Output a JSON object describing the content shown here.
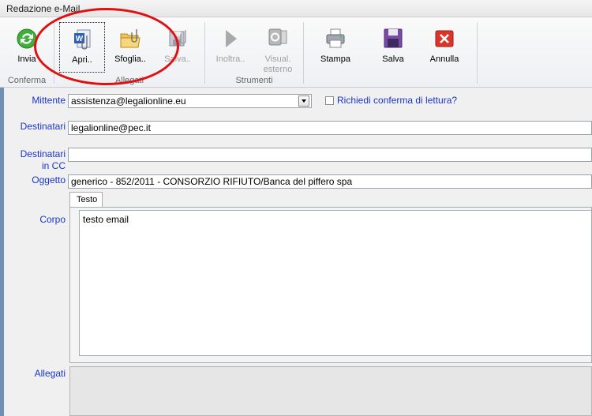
{
  "window": {
    "title": "Redazione e-Mail"
  },
  "ribbon": {
    "groups": [
      {
        "label": "Conferma"
      },
      {
        "label": "Allegati"
      },
      {
        "label": "Strumenti"
      }
    ],
    "buttons": {
      "invia": "Invia",
      "apri": "Apri..",
      "sfoglia": "Sfoglia..",
      "salva_allegato": "Salva..",
      "inoltra": "Inoltra..",
      "visual_esterno_1": "Visual.",
      "visual_esterno_2": "esterno",
      "stampa": "Stampa",
      "salva": "Salva",
      "annulla": "Annulla"
    }
  },
  "form": {
    "mittente_label": "Mittente",
    "mittente_value": "assistenza@legalionline.eu",
    "conferma_label": "Richiedi conferma di lettura?",
    "destinatari_label": "Destinatari",
    "destinatari_value": "legalionline@pec.it",
    "cc_label_1": "Destinatari",
    "cc_label_2": "in CC",
    "cc_value": "",
    "oggetto_label": "Oggetto",
    "oggetto_value": "generico - 852/2011 - CONSORZIO RIFIUTO/Banca del piffero spa",
    "corpo_label": "Corpo",
    "tab_testo": "Testo",
    "corpo_value": "testo email",
    "allegati_label": "Allegati"
  },
  "colors": {
    "label_blue": "#1a35c8",
    "callout_red": "#e01010",
    "strip_blue": "#6f8fb3"
  }
}
